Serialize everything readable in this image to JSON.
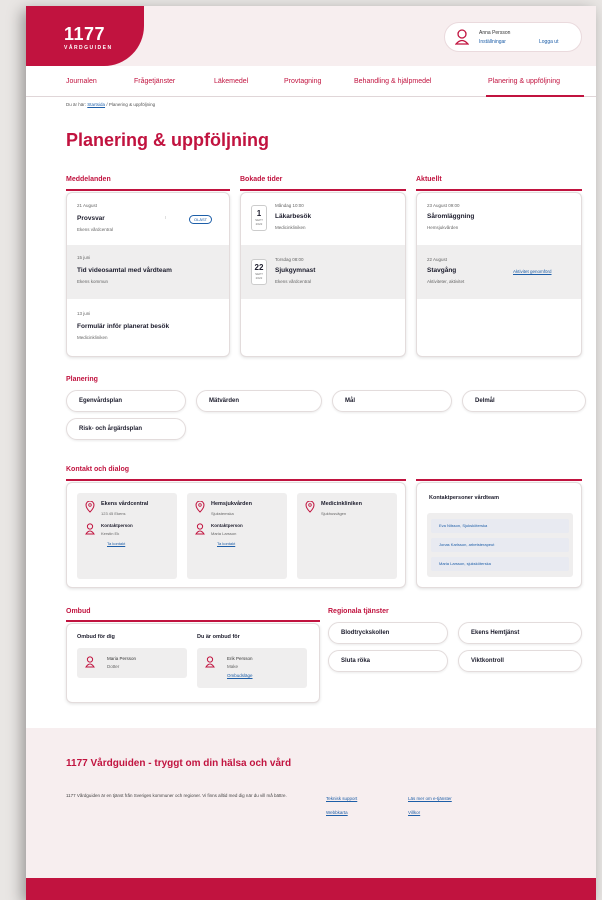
{
  "logo": {
    "number": "1177",
    "subtitle": "VÅRDGUIDEN"
  },
  "user": {
    "name": "Anna Persson",
    "settings": "Inställningar",
    "logout": "Logga ut"
  },
  "nav": [
    "Journalen",
    "Frågetjänster",
    "Läkemedel",
    "Provtagning",
    "Behandling & hjälpmedel",
    "Planering & uppföljning"
  ],
  "breadcrumb": {
    "prefix": "Du är här:",
    "link": "Startsida",
    "current": "/ Planering & uppföljning"
  },
  "page_title": "Planering & uppföljning",
  "meddelanden": {
    "title": "Meddelanden",
    "items": [
      {
        "date": "21 August",
        "title": "Provsvar",
        "sub": "Ekens vårdcentral",
        "badge": "OLÄST"
      },
      {
        "date": "15 juni",
        "title": "Tid videosamtal med vårdteam",
        "sub": "Ekens kommun"
      },
      {
        "date": "13 juni",
        "title": "Formulär inför planerat besök",
        "sub": "Medicinkliniken"
      }
    ]
  },
  "bokade": {
    "title": "Bokade tider",
    "items": [
      {
        "day": "1",
        "month": "SEPT",
        "year": "2022",
        "time": "Måndag 10:00",
        "title": "Läkarbesök",
        "sub": "Medicinkliniken"
      },
      {
        "day": "22",
        "month": "SEPT",
        "year": "2022",
        "time": "Torsdag 08:00",
        "title": "Sjukgymnast",
        "sub": "Ekens vårdcentral"
      }
    ]
  },
  "aktuellt": {
    "title": "Aktuellt",
    "items": [
      {
        "date": "23 August 09:00",
        "title": "Såromläggning",
        "sub": "Hemsjukvården"
      },
      {
        "date": "22 August",
        "title": "Stavgång",
        "sub": "Aktiviteter, aktivitet",
        "link": "Aktivitet genomförd"
      }
    ]
  },
  "planering": {
    "title": "Planering",
    "items": [
      "Egenvårdsplan",
      "Mätvärden",
      "Mål",
      "Delmål",
      "Risk- och årgärdsplan"
    ]
  },
  "kontakt": {
    "title": "Kontakt och dialog",
    "units": [
      {
        "name": "Ekens vårdcentral",
        "address": "123 45 Ekens",
        "contact_label": "Kontaktperson",
        "contact_name": "Kerstin Ek",
        "link": "Ta kontakt"
      },
      {
        "name": "Hemsjukvården",
        "address": "Sjukstemska",
        "contact_label": "Kontaktperson",
        "contact_name": "Maria Larsson",
        "link": "Ta kontakt"
      },
      {
        "name": "Medicinkliniken",
        "address": "Sjukhusvägen"
      }
    ],
    "team_title": "Kontaktpersoner vårdteam",
    "team": [
      "Eva Nilsson, Sjuksköterska",
      "Jonas Karlsson, arbetsterapeut",
      "Maria Larsson, sjuksköterska"
    ]
  },
  "ombud": {
    "title": "Ombud",
    "left_title": "Ombud för dig",
    "right_title": "Du är ombud för",
    "left": {
      "name": "Maria Persson",
      "role": "Dotter"
    },
    "right": {
      "name": "Erik Persson",
      "role": "Make",
      "link": "Ombudsläge"
    }
  },
  "regionala": {
    "title": "Regionala tjänster",
    "items": [
      "Blodtryckskollen",
      "Ekens Hemtjänst",
      "Sluta röka",
      "Viktkontroll"
    ]
  },
  "footer": {
    "title": "1177 Vårdguiden - tryggt om din hälsa och vård",
    "text": "1177 Vårdguiden är en tjänst från Sveriges kommuner och regioner. Vi finns alltid med dig när du vill må bättre.",
    "links": [
      "Teknisk support",
      "Läs mer om e-tjänster",
      "Webbkarta",
      "Villkor"
    ]
  },
  "colors": {
    "brand": "#c1133f",
    "link": "#1d5ea8",
    "header_bg": "#f7eeef"
  }
}
